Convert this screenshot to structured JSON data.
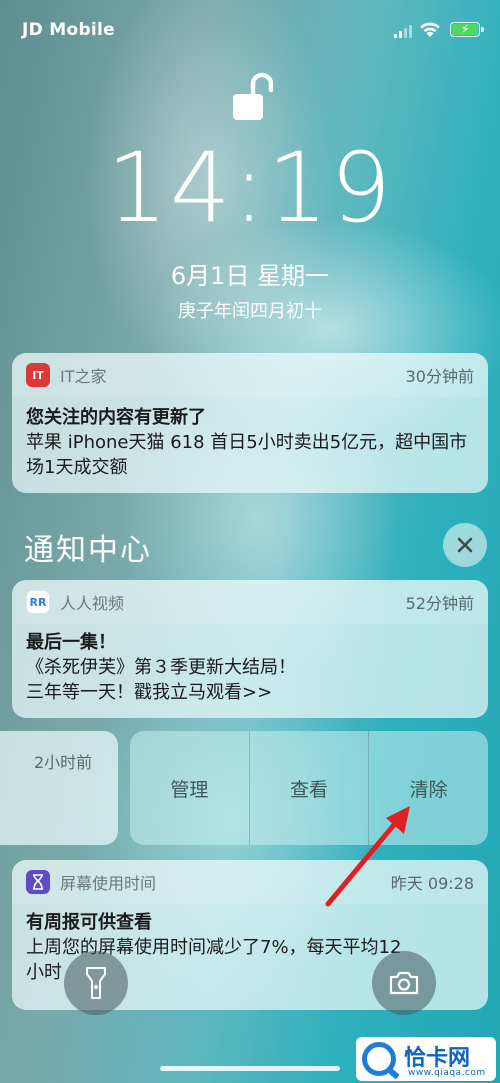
{
  "status_bar": {
    "carrier": "JD Mobile",
    "battery_color": "#4cd964"
  },
  "lock_screen": {
    "time": "14:19",
    "date": "6月1日 星期一",
    "lunar_date": "庚子年闰四月初十",
    "lock_icon": "unlocked-padlock-icon"
  },
  "notifications": [
    {
      "app": "IT之家",
      "icon": "ithome-icon",
      "icon_color": "#d93a35",
      "time": "30分钟前",
      "title": "您关注的内容有更新了",
      "body": "苹果 iPhone天猫 618 首日5小时卖出5亿元，超中国市场1天成交额"
    }
  ],
  "notification_center": {
    "title": "通知中心",
    "clear_icon": "close-icon",
    "items": [
      {
        "app": "人人视频",
        "icon": "renren-video-icon",
        "icon_color": "#2a7de1",
        "time": "52分钟前",
        "title": "最后一集！",
        "body_line1": "《杀死伊芙》第３季更新大结局！",
        "body_line2": "三年等一天！戳我立马观看>>"
      },
      {
        "swiped": true,
        "time": "2小时前",
        "actions": [
          "管理",
          "查看",
          "清除"
        ]
      },
      {
        "app": "屏幕使用时间",
        "icon": "hourglass-icon",
        "icon_color": "#5e4bc7",
        "time": "昨天 09:28",
        "title": "有周报可供查看",
        "body_line1": "上周您的屏幕使用时间减少了7%，每天平均12",
        "body_line2": "小时"
      }
    ]
  },
  "bottom_controls": {
    "left": "flashlight-icon",
    "right": "camera-icon"
  },
  "watermark": {
    "text": "恰卡网",
    "sub": "www.qiaqa.com"
  },
  "annotation": {
    "arrow_color": "#e02020"
  }
}
